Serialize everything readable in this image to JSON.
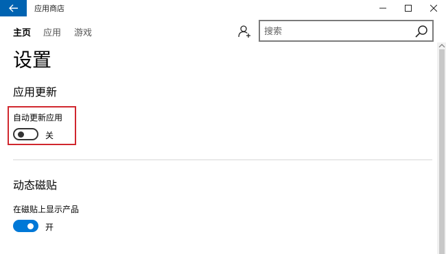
{
  "window": {
    "title": "应用商店"
  },
  "nav": {
    "items": [
      {
        "label": "主页",
        "active": true
      },
      {
        "label": "应用",
        "active": false
      },
      {
        "label": "游戏",
        "active": false
      }
    ]
  },
  "search": {
    "value": "",
    "placeholder": "搜索"
  },
  "page": {
    "title": "设置"
  },
  "sections": {
    "updates": {
      "title": "应用更新",
      "setting_label": "自动更新应用",
      "toggle_state": "关",
      "toggle_on": false
    },
    "tiles": {
      "title": "动态磁贴",
      "setting_label": "在磁贴上显示产品",
      "toggle_state": "开",
      "toggle_on": true
    }
  },
  "colors": {
    "accent": "#0078d7",
    "back_button": "#0063b1",
    "highlight": "#d0262d"
  },
  "icons": {
    "back": "back-arrow-icon",
    "user": "user-add-icon",
    "search": "search-icon",
    "minimize": "minimize-icon",
    "maximize": "maximize-icon",
    "close": "close-icon"
  }
}
